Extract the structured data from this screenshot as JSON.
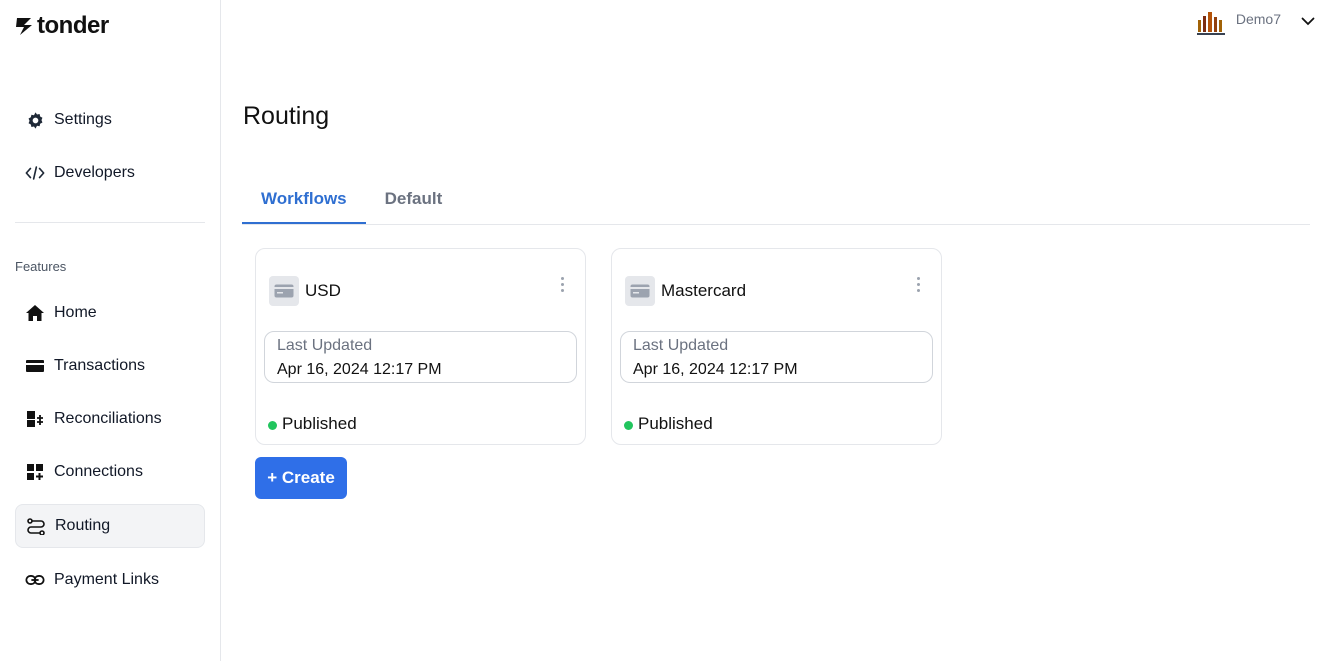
{
  "brand": {
    "name": "tonder"
  },
  "user": {
    "name": "Demo7"
  },
  "sidebar": {
    "top_items": [
      {
        "label": "Settings",
        "icon": "gear-icon"
      },
      {
        "label": "Developers",
        "icon": "code-icon"
      }
    ],
    "section_label": "Features",
    "items": [
      {
        "label": "Home",
        "icon": "home-icon"
      },
      {
        "label": "Transactions",
        "icon": "card-icon"
      },
      {
        "label": "Reconciliations",
        "icon": "reconcile-icon"
      },
      {
        "label": "Connections",
        "icon": "grid-plus-icon"
      },
      {
        "label": "Routing",
        "icon": "route-icon",
        "active": true
      },
      {
        "label": "Payment Links",
        "icon": "link-icon"
      }
    ]
  },
  "main": {
    "title": "Routing",
    "tabs": [
      {
        "label": "Workflows",
        "active": true
      },
      {
        "label": "Default",
        "active": false
      }
    ],
    "workflows": [
      {
        "name": "USD",
        "updated_label": "Last Updated",
        "updated_value": "Apr 16, 2024 12:17 PM",
        "status": "Published"
      },
      {
        "name": "Mastercard",
        "updated_label": "Last Updated",
        "updated_value": "Apr 16, 2024 12:17 PM",
        "status": "Published"
      }
    ],
    "create_label": "+ Create"
  },
  "colors": {
    "accent": "#2f6fe8",
    "tab_active": "#2f6fd1",
    "status_published": "#22c55e"
  }
}
